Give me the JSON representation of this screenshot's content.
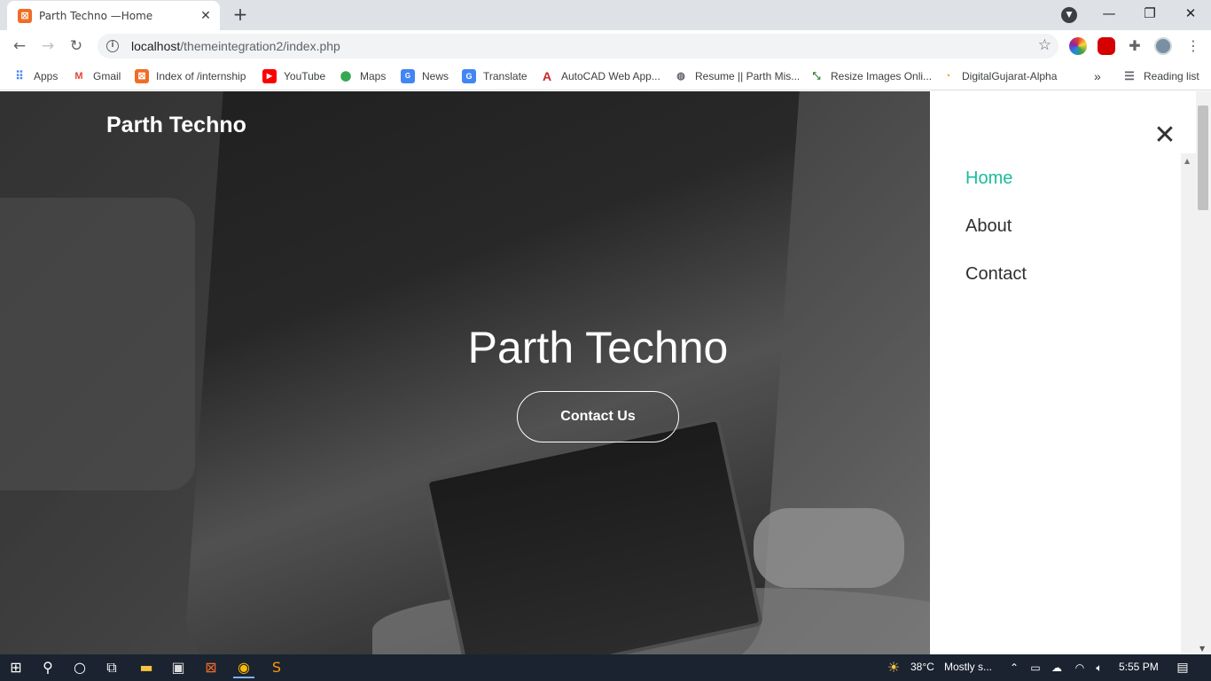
{
  "browser": {
    "tab_title": "Parth Techno —Home",
    "url_host": "localhost",
    "url_path": "/themeintegration2/index.php",
    "bookmarks": [
      {
        "label": "Apps",
        "icon": "apps-grid-icon"
      },
      {
        "label": "Gmail",
        "icon": "gmail-icon"
      },
      {
        "label": "Index of /internship",
        "icon": "xampp-icon"
      },
      {
        "label": "YouTube",
        "icon": "youtube-icon"
      },
      {
        "label": "Maps",
        "icon": "maps-icon"
      },
      {
        "label": "News",
        "icon": "news-icon"
      },
      {
        "label": "Translate",
        "icon": "translate-icon"
      },
      {
        "label": "AutoCAD Web App...",
        "icon": "autocad-icon"
      },
      {
        "label": "Resume || Parth Mis...",
        "icon": "globe-icon"
      },
      {
        "label": "Resize Images Onli...",
        "icon": "resize-icon"
      },
      {
        "label": "DigitalGujarat-Alpha",
        "icon": "digitalgujarat-icon"
      }
    ],
    "reading_list": "Reading list"
  },
  "page": {
    "brand": "Parth Techno",
    "headline": "Parth Techno",
    "cta": "Contact Us",
    "nav": [
      {
        "label": "Home",
        "active": true
      },
      {
        "label": "About",
        "active": false
      },
      {
        "label": "Contact",
        "active": false
      }
    ]
  },
  "taskbar": {
    "weather": "38°C",
    "weather_desc": "Mostly s...",
    "time": "5:55 PM"
  },
  "colors": {
    "accent": "#1abc9c",
    "tabstrip": "#dee1e6",
    "taskbar": "#1b2331"
  }
}
